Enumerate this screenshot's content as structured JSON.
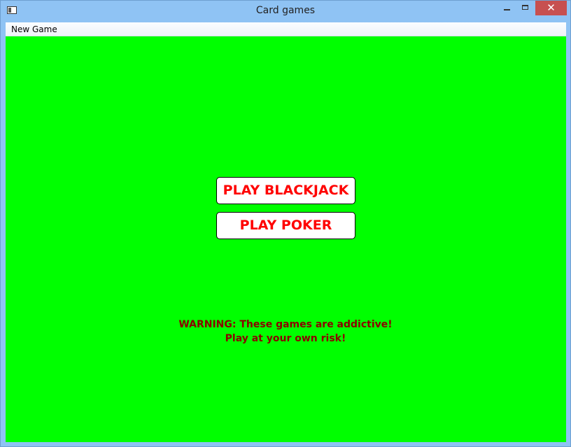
{
  "window": {
    "title": "Card games",
    "close_glyph": "✕",
    "icons": [
      "app-icon",
      "minimize-icon",
      "maximize-icon",
      "close-icon"
    ]
  },
  "menubar": {
    "items": [
      {
        "label": "New Game"
      }
    ]
  },
  "main": {
    "background_color": "#00ff00",
    "buttons": {
      "blackjack_label": "PLAY BLACKJACK",
      "poker_label": "PLAY POKER",
      "text_color": "#ff0000"
    },
    "warning": {
      "line1": "WARNING: These games are addictive!",
      "line2": "Play at your own risk!",
      "color": "#8b0000"
    }
  }
}
